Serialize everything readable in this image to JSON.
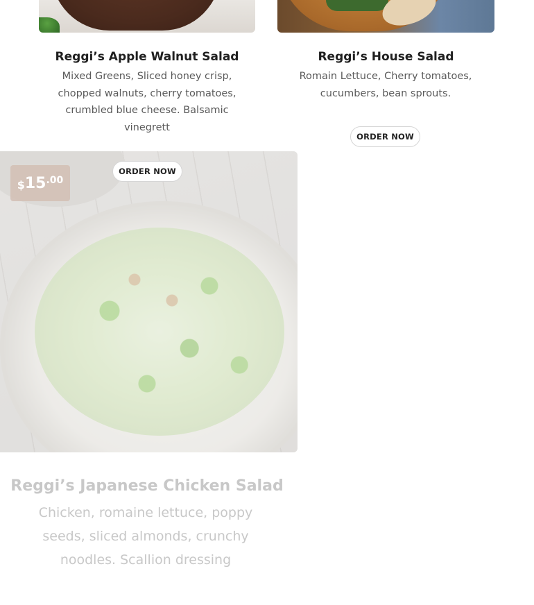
{
  "cards": [
    {
      "title": "Reggi’s Apple Walnut Salad",
      "description": "Mixed Greens, Sliced honey crisp, chopped walnuts, cherry tomatoes, crumbled blue cheese. Balsamic vinegrett",
      "button_label": "ORDER NOW"
    },
    {
      "title": "Reggi’s House Salad",
      "description": "Romain Lettuce, Cherry tomatoes, cucumbers, bean sprouts.",
      "button_label": "ORDER NOW"
    },
    {
      "title": "Reggi’s Japanese Chicken Salad",
      "description": "Chicken, romaine lettuce, poppy seeds, sliced almonds, crunchy noodles. Scallion dressing",
      "price": {
        "currency": "$",
        "whole": "15",
        "cents": ".00"
      }
    }
  ],
  "colors": {
    "button_border": "#d6d6d6",
    "faded_text": "#c8c8c8",
    "badge_bg": "#d2beb4"
  }
}
